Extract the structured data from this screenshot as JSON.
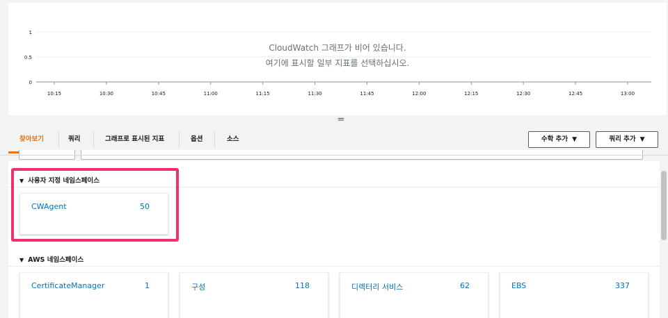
{
  "graph": {
    "empty_line1": "CloudWatch 그래프가 비어 있습니다.",
    "empty_line2": "여기에 표시할 일부 지표를 선택하십시오.",
    "y_ticks": [
      "1",
      "0.5",
      "0"
    ],
    "x_ticks": [
      "10:15",
      "10:30",
      "10:45",
      "11:00",
      "11:15",
      "11:30",
      "11:45",
      "12:00",
      "12:15",
      "12:30",
      "12:45",
      "13:00"
    ]
  },
  "tabs": {
    "browse": "찾아보기",
    "query": "쿼리",
    "graphed_metrics": "그래프로 표시된 지표",
    "options": "옵션",
    "source": "소스",
    "add_math": "수학 추가",
    "add_query": "쿼리 추가",
    "caret": "▼",
    "resize": "="
  },
  "custom_namespaces": {
    "header": "사용자 지정 네임스페이스",
    "tri": "▼",
    "items": [
      {
        "name": "CWAgent",
        "count": "50"
      }
    ]
  },
  "aws_namespaces": {
    "header": "AWS 네임스페이스",
    "tri": "▼",
    "items": [
      {
        "name": "CertificateManager",
        "count": "1"
      },
      {
        "name": "구성",
        "count": "118"
      },
      {
        "name": "디렉터리 서비스",
        "count": "62"
      },
      {
        "name": "EBS",
        "count": "337"
      }
    ]
  },
  "colors": {
    "accent": "#ec7211",
    "link": "#0073bb",
    "highlight": "#f0306a"
  }
}
